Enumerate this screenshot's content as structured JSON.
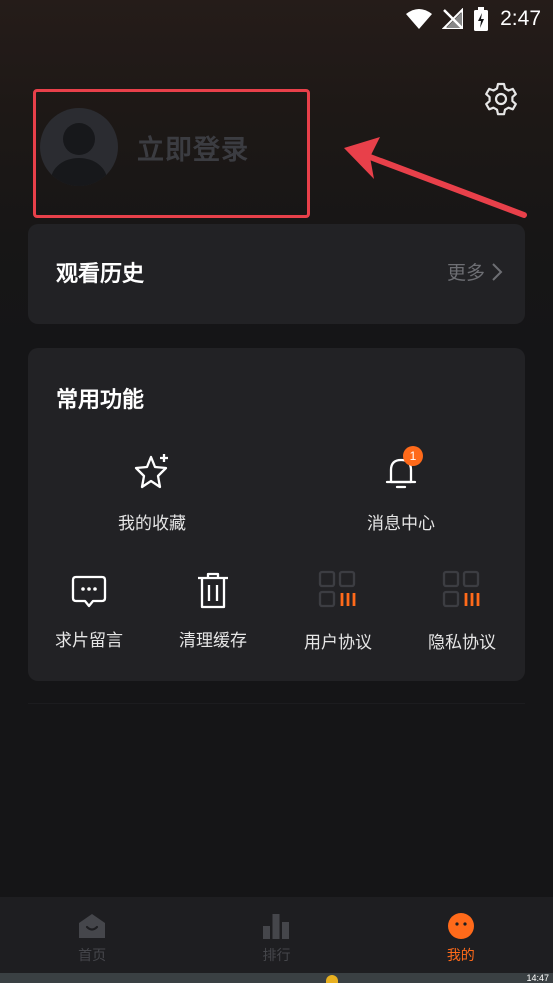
{
  "status_bar": {
    "time": "2:47"
  },
  "profile": {
    "login_label": "立即登录"
  },
  "history": {
    "title": "观看历史",
    "more_label": "更多"
  },
  "functions": {
    "title": "常用功能",
    "items": [
      {
        "label": "我的收藏",
        "icon": "star-icon"
      },
      {
        "label": "消息中心",
        "icon": "bell-icon",
        "badge": "1"
      },
      {
        "label": "求片留言",
        "icon": "chat-bubble-icon"
      },
      {
        "label": "清理缓存",
        "icon": "trash-icon"
      },
      {
        "label": "用户协议",
        "icon": "grid-bars-icon"
      },
      {
        "label": "隐私协议",
        "icon": "grid-bars-icon"
      }
    ]
  },
  "tabs": [
    {
      "label": "首页",
      "icon": "home-icon",
      "active": false
    },
    {
      "label": "排行",
      "icon": "ranking-icon",
      "active": false
    },
    {
      "label": "我的",
      "icon": "profile-face-icon",
      "active": true
    }
  ],
  "system_strip": {
    "time": "14:47"
  },
  "colors": {
    "accent": "#ff6a1a",
    "highlight": "#e8404a",
    "card": "#222225",
    "background": "#151517"
  }
}
